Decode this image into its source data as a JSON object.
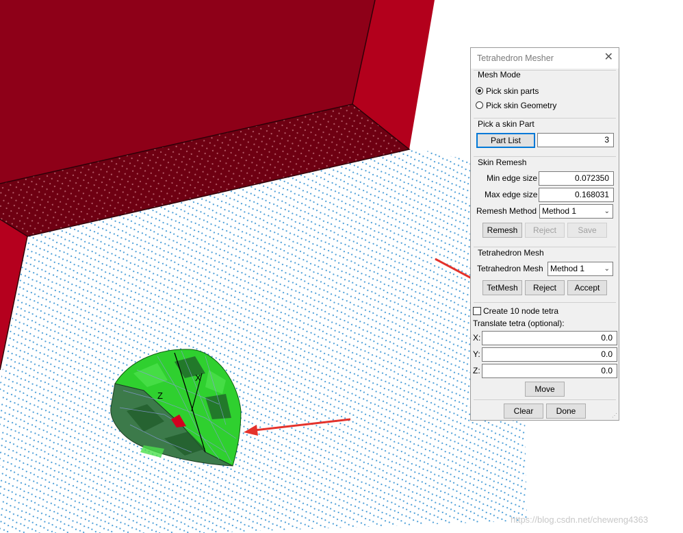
{
  "dialog": {
    "title": "Tetrahedron Mesher",
    "mesh_mode": {
      "group_label": "Mesh Mode",
      "options": [
        "Pick skin parts",
        "Pick skin Geometry"
      ],
      "selected": "Pick skin parts"
    },
    "pick_skin_part": {
      "group_label": "Pick a skin Part",
      "button_label": "Part List",
      "value": "3"
    },
    "skin_remesh": {
      "group_label": "Skin Remesh",
      "min_edge_label": "Min edge size",
      "min_edge_value": "0.072350",
      "max_edge_label": "Max edge size",
      "max_edge_value": "0.168031",
      "method_label": "Remesh Method",
      "method_value": "Method 1",
      "remesh_button": "Remesh",
      "reject_button": "Reject",
      "save_button": "Save"
    },
    "tet_mesh": {
      "group_label": "Tetrahedron Mesh",
      "method_label": "Tetrahedron Mesh",
      "method_value": "Method 1",
      "tetmesh_button": "TetMesh",
      "reject_button": "Reject",
      "accept_button": "Accept"
    },
    "create_10_node": {
      "label": "Create 10 node tetra",
      "checked": false
    },
    "translate": {
      "label": "Translate tetra (optional):",
      "x_label": "X:",
      "x_value": "0.0",
      "y_label": "Y:",
      "y_value": "0.0",
      "z_label": "Z:",
      "z_value": "0.0",
      "move_button": "Move"
    },
    "clear_button": "Clear",
    "done_button": "Done"
  },
  "viewport": {
    "axis_x": "X",
    "axis_z": "Z",
    "colors": {
      "solid_red": "#8e0018",
      "mesh_green": "#2fd02f",
      "points": "#4fa0d8",
      "arrow": "#e4322b"
    }
  },
  "watermark": "https://blog.csdn.net/cheweng4363"
}
